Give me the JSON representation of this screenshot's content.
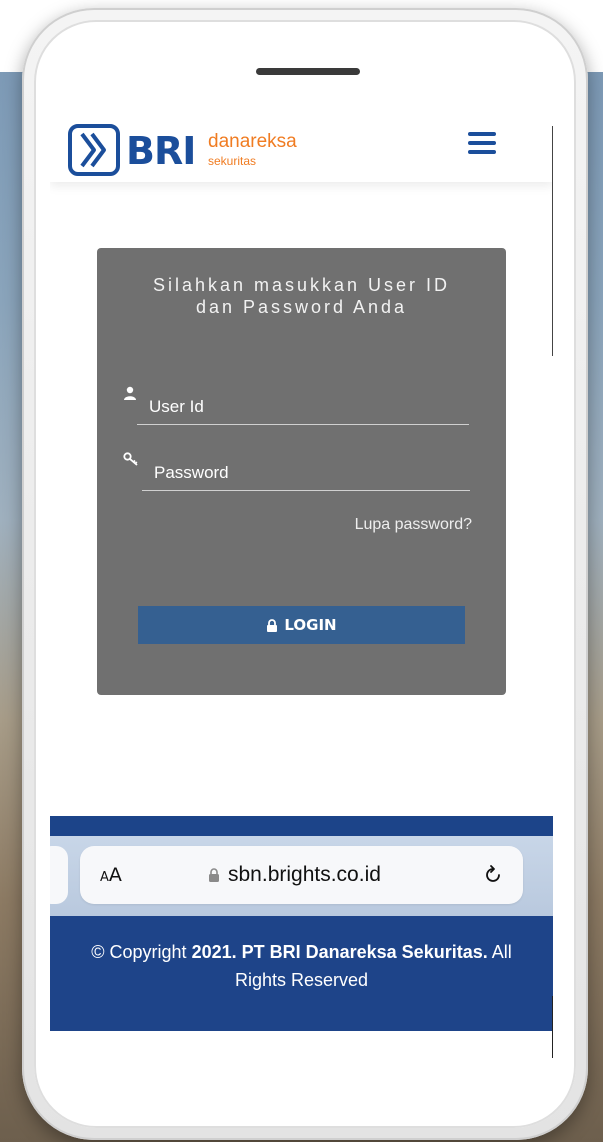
{
  "header": {
    "logo_bri": "BRI",
    "logo_brand": "danareksa",
    "logo_sub": "sekuritas",
    "menu_icon": "hamburger-menu-icon"
  },
  "login": {
    "title_line1": "Silahkan masukkan User ID",
    "title_line2": "dan Password Anda",
    "user_placeholder": "User Id",
    "password_placeholder": "Password",
    "forgot_label": "Lupa password?",
    "login_label": "LOGIN",
    "user_icon": "user-icon",
    "key_icon": "key-icon",
    "lock_icon": "lock-icon"
  },
  "browser": {
    "text_size_label": "AA",
    "url": "sbn.brights.co.id",
    "lock_icon": "lock-icon",
    "reload_icon": "reload-icon"
  },
  "footer": {
    "prefix": "© Copyright ",
    "bold": "2021. PT BRI Danareksa Sekuritas.",
    "suffix": " All Rights Reserved"
  },
  "colors": {
    "brand_blue": "#1b4e9b",
    "brand_orange": "#f07c22",
    "card_gray": "#707070",
    "button_blue": "#356091",
    "footer_blue": "#1e4489"
  }
}
